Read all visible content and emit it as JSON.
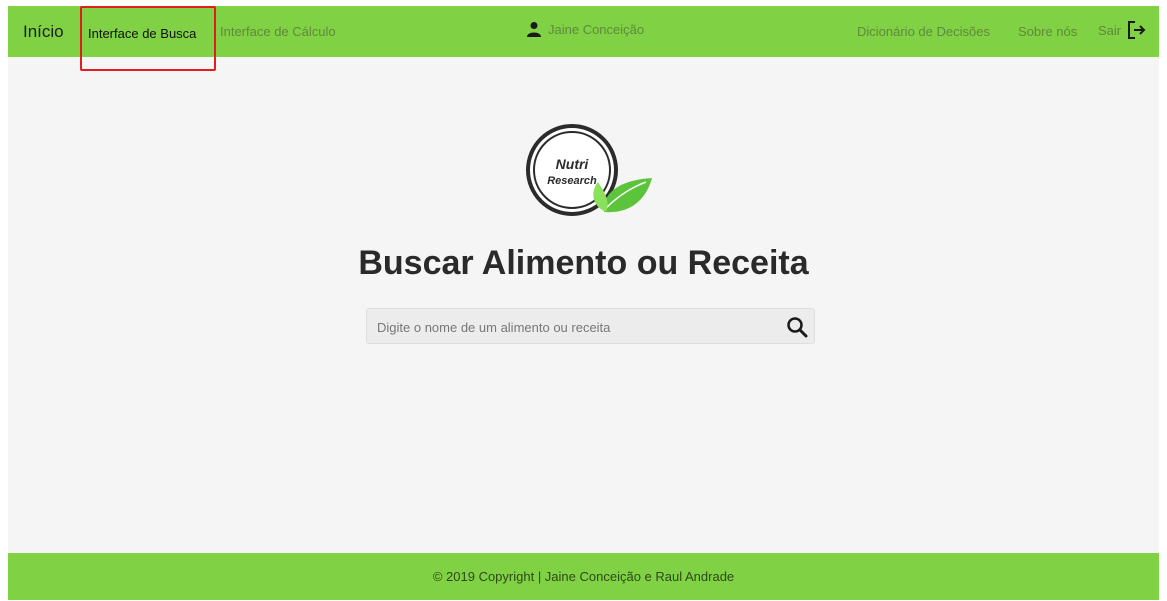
{
  "navbar": {
    "brand": "Início",
    "active_link": "Interface de Busca",
    "calc_link": "Interface de Cálculo",
    "user_name": "Jaine Conceição",
    "dictionary_link": "Dicionário de Decisões",
    "about_link": "Sobre nós",
    "exit_link": "Sair"
  },
  "logo": {
    "line1": "Nutri",
    "line2": "Research"
  },
  "main": {
    "title": "Buscar Alimento ou Receita",
    "search_placeholder": "Digite o nome de um alimento ou receita"
  },
  "footer": {
    "copyright": "© 2019 Copyright | Jaine Conceição e Raul Andrade"
  },
  "colors": {
    "accent_green": "#80d143",
    "highlight_box": "#e11d1d",
    "leaf_green": "#5cc43a"
  },
  "icons": {
    "user": "user-icon",
    "exit": "logout-icon",
    "search": "search-icon"
  }
}
